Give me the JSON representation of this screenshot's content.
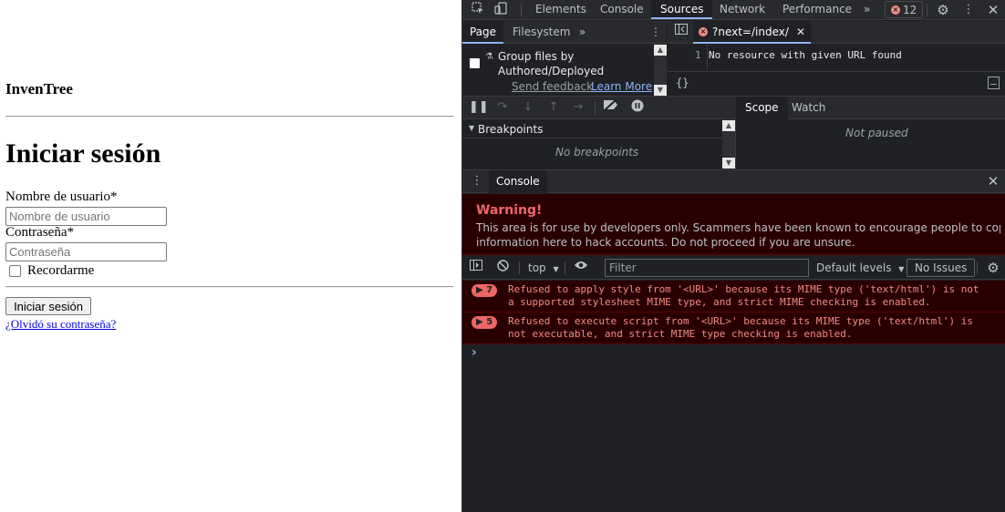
{
  "page": {
    "brand": "InvenTree",
    "title": "Iniciar sesión",
    "username_label": "Nombre de usuario*",
    "username_placeholder": "Nombre de usuario",
    "password_label": "Contraseña*",
    "password_placeholder": "Contraseña",
    "remember_label": "Recordarme",
    "submit_label": "Iniciar sesión",
    "forgot_link": "¿Olvidó su contraseña?"
  },
  "devtools": {
    "tabs": [
      "Elements",
      "Console",
      "Sources",
      "Network",
      "Performance"
    ],
    "active_tab": "Sources",
    "more_tabs": "»",
    "error_count": "12",
    "navigator": {
      "tabs": [
        "Page",
        "Filesystem"
      ],
      "more": "»",
      "group_label_1": "Group files by",
      "group_label_2": "Authored/Deployed",
      "send_feedback": "Send feedback",
      "learn_more": "Learn More"
    },
    "editor": {
      "file_tab": "?next=/index/",
      "line_number": "1",
      "line_text": "No resource with given URL found",
      "format_icon": "{}"
    },
    "debugger": {
      "breakpoints_title": "Breakpoints",
      "no_breakpoints": "No breakpoints",
      "scope_tabs": [
        "Scope",
        "Watch"
      ],
      "not_paused": "Not paused"
    },
    "drawer": {
      "tab": "Console",
      "warning_title": "Warning!",
      "warning_text_1": "This area is for use by developers only. Scammers have been known to encourage people to copy/paste",
      "warning_text_2": "information here to hack accounts. Do not proceed if you are unsure.",
      "context": "top",
      "filter_placeholder": "Filter",
      "levels": "Default levels",
      "issues": "No Issues",
      "messages": [
        {
          "count": "7",
          "line1": "Refused to apply style from '<URL>' because its MIME type ('text/html') is not",
          "line2": "a supported stylesheet MIME type, and strict MIME checking is enabled."
        },
        {
          "count": "5",
          "line1": "Refused to execute script from '<URL>' because its MIME type ('text/html') is",
          "line2": "not executable, and strict MIME type checking is enabled."
        }
      ],
      "prompt": "›"
    }
  }
}
